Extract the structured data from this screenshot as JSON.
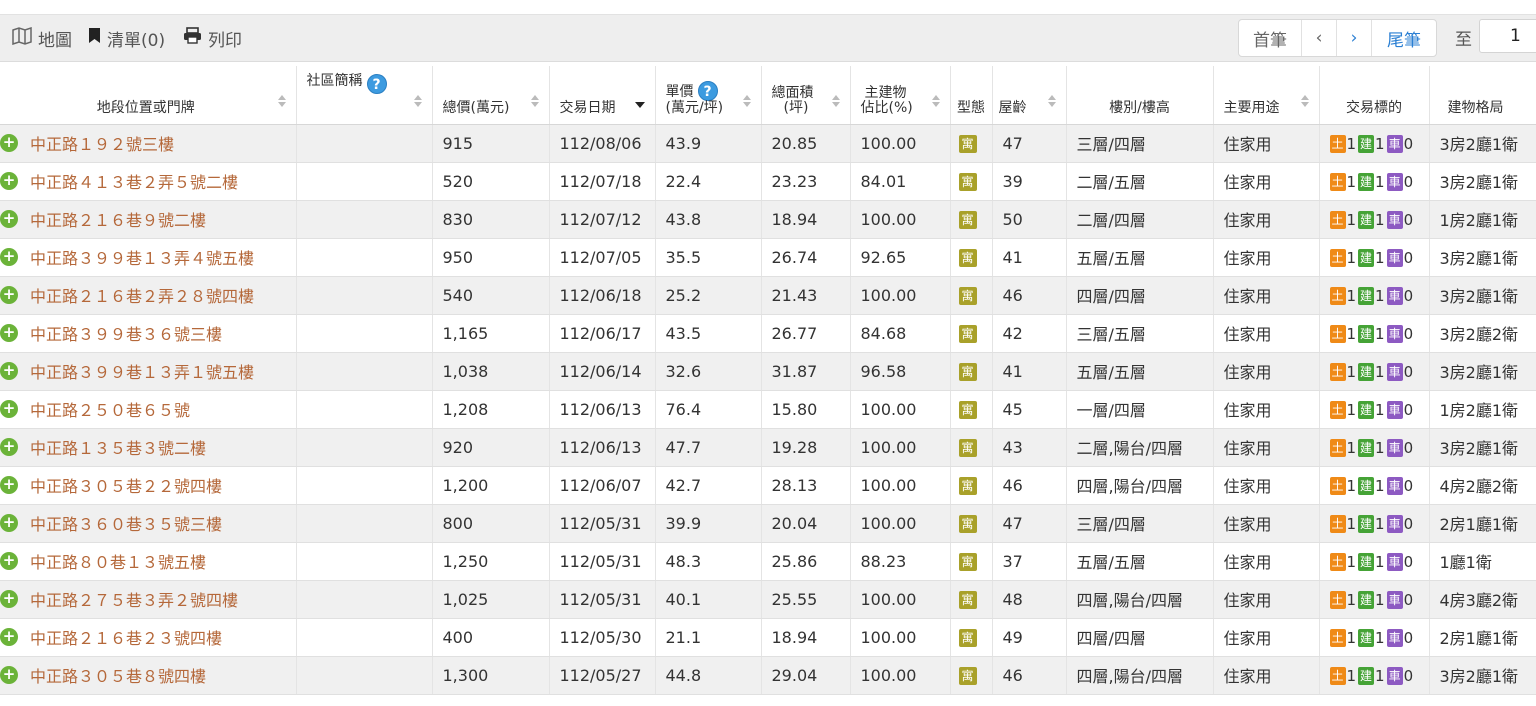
{
  "toolbar": {
    "map_label": "地圖",
    "list_label": "清單(0)",
    "print_label": "列印",
    "first_label": "首筆",
    "prev_label": "‹",
    "next_label": "›",
    "last_label": "尾筆",
    "to_label": "至",
    "page_value": "1"
  },
  "colors": {
    "address_link": "#b5683a",
    "row_alt": "#f0f0f0",
    "land_tag": "#ef8a17",
    "building_tag": "#45a336",
    "parking_tag": "#8d5ac2",
    "type_badge": "#a9a12a",
    "expand_icon": "#6bb339"
  },
  "columns": {
    "address": "地段位置或門牌",
    "community": "社區簡稱",
    "total_price": "總價(萬元)",
    "date": "交易日期",
    "unit_price_1": "單價",
    "unit_price_2": "(萬元/坪)",
    "area_1": "總面積",
    "area_2": "(坪)",
    "main_ratio_1": "主建物",
    "main_ratio_2": "佔比(%)",
    "type": "型態",
    "age": "屋齡",
    "floor": "樓別/樓高",
    "usage": "主要用途",
    "target": "交易標的",
    "layout": "建物格局"
  },
  "rows": [
    {
      "address": "中正路１９２號三樓",
      "total": "915",
      "date": "112/08/06",
      "unit": "43.9",
      "area": "20.85",
      "ratio": "100.00",
      "type": "寓",
      "age": "47",
      "floor": "三層/四層",
      "usage": "住家用",
      "land": "1",
      "bldg": "1",
      "park": "0",
      "layout": "3房2廳1衛"
    },
    {
      "address": "中正路４１３巷２弄５號二樓",
      "total": "520",
      "date": "112/07/18",
      "unit": "22.4",
      "area": "23.23",
      "ratio": "84.01",
      "type": "寓",
      "age": "39",
      "floor": "二層/五層",
      "usage": "住家用",
      "land": "1",
      "bldg": "1",
      "park": "0",
      "layout": "3房2廳1衛"
    },
    {
      "address": "中正路２１６巷９號二樓",
      "total": "830",
      "date": "112/07/12",
      "unit": "43.8",
      "area": "18.94",
      "ratio": "100.00",
      "type": "寓",
      "age": "50",
      "floor": "二層/四層",
      "usage": "住家用",
      "land": "1",
      "bldg": "1",
      "park": "0",
      "layout": "1房2廳1衛"
    },
    {
      "address": "中正路３９９巷１３弄４號五樓",
      "total": "950",
      "date": "112/07/05",
      "unit": "35.5",
      "area": "26.74",
      "ratio": "92.65",
      "type": "寓",
      "age": "41",
      "floor": "五層/五層",
      "usage": "住家用",
      "land": "1",
      "bldg": "1",
      "park": "0",
      "layout": "3房2廳1衛"
    },
    {
      "address": "中正路２１６巷２弄２８號四樓",
      "total": "540",
      "date": "112/06/18",
      "unit": "25.2",
      "area": "21.43",
      "ratio": "100.00",
      "type": "寓",
      "age": "46",
      "floor": "四層/四層",
      "usage": "住家用",
      "land": "1",
      "bldg": "1",
      "park": "0",
      "layout": "3房2廳1衛"
    },
    {
      "address": "中正路３９９巷３６號三樓",
      "total": "1,165",
      "date": "112/06/17",
      "unit": "43.5",
      "area": "26.77",
      "ratio": "84.68",
      "type": "寓",
      "age": "42",
      "floor": "三層/五層",
      "usage": "住家用",
      "land": "1",
      "bldg": "1",
      "park": "0",
      "layout": "3房2廳2衛"
    },
    {
      "address": "中正路３９９巷１３弄１號五樓",
      "total": "1,038",
      "date": "112/06/14",
      "unit": "32.6",
      "area": "31.87",
      "ratio": "96.58",
      "type": "寓",
      "age": "41",
      "floor": "五層/五層",
      "usage": "住家用",
      "land": "1",
      "bldg": "1",
      "park": "0",
      "layout": "3房2廳1衛"
    },
    {
      "address": "中正路２５０巷６５號",
      "total": "1,208",
      "date": "112/06/13",
      "unit": "76.4",
      "area": "15.80",
      "ratio": "100.00",
      "type": "寓",
      "age": "45",
      "floor": "一層/四層",
      "usage": "住家用",
      "land": "1",
      "bldg": "1",
      "park": "0",
      "layout": "1房2廳1衛"
    },
    {
      "address": "中正路１３５巷３號二樓",
      "total": "920",
      "date": "112/06/13",
      "unit": "47.7",
      "area": "19.28",
      "ratio": "100.00",
      "type": "寓",
      "age": "43",
      "floor": "二層,陽台/四層",
      "usage": "住家用",
      "land": "1",
      "bldg": "1",
      "park": "0",
      "layout": "3房2廳1衛"
    },
    {
      "address": "中正路３０５巷２２號四樓",
      "total": "1,200",
      "date": "112/06/07",
      "unit": "42.7",
      "area": "28.13",
      "ratio": "100.00",
      "type": "寓",
      "age": "46",
      "floor": "四層,陽台/四層",
      "usage": "住家用",
      "land": "1",
      "bldg": "1",
      "park": "0",
      "layout": "4房2廳2衛"
    },
    {
      "address": "中正路３６０巷３５號三樓",
      "total": "800",
      "date": "112/05/31",
      "unit": "39.9",
      "area": "20.04",
      "ratio": "100.00",
      "type": "寓",
      "age": "47",
      "floor": "三層/四層",
      "usage": "住家用",
      "land": "1",
      "bldg": "1",
      "park": "0",
      "layout": "2房1廳1衛"
    },
    {
      "address": "中正路８０巷１３號五樓",
      "total": "1,250",
      "date": "112/05/31",
      "unit": "48.3",
      "area": "25.86",
      "ratio": "88.23",
      "type": "寓",
      "age": "37",
      "floor": "五層/五層",
      "usage": "住家用",
      "land": "1",
      "bldg": "1",
      "park": "0",
      "layout": "1廳1衛"
    },
    {
      "address": "中正路２７５巷３弄２號四樓",
      "total": "1,025",
      "date": "112/05/31",
      "unit": "40.1",
      "area": "25.55",
      "ratio": "100.00",
      "type": "寓",
      "age": "48",
      "floor": "四層,陽台/四層",
      "usage": "住家用",
      "land": "1",
      "bldg": "1",
      "park": "0",
      "layout": "4房3廳2衛"
    },
    {
      "address": "中正路２１６巷２３號四樓",
      "total": "400",
      "date": "112/05/30",
      "unit": "21.1",
      "area": "18.94",
      "ratio": "100.00",
      "type": "寓",
      "age": "49",
      "floor": "四層/四層",
      "usage": "住家用",
      "land": "1",
      "bldg": "1",
      "park": "0",
      "layout": "2房1廳1衛"
    },
    {
      "address": "中正路３０５巷８號四樓",
      "total": "1,300",
      "date": "112/05/27",
      "unit": "44.8",
      "area": "29.04",
      "ratio": "100.00",
      "type": "寓",
      "age": "46",
      "floor": "四層,陽台/四層",
      "usage": "住家用",
      "land": "1",
      "bldg": "1",
      "park": "0",
      "layout": "3房2廳1衛"
    }
  ]
}
